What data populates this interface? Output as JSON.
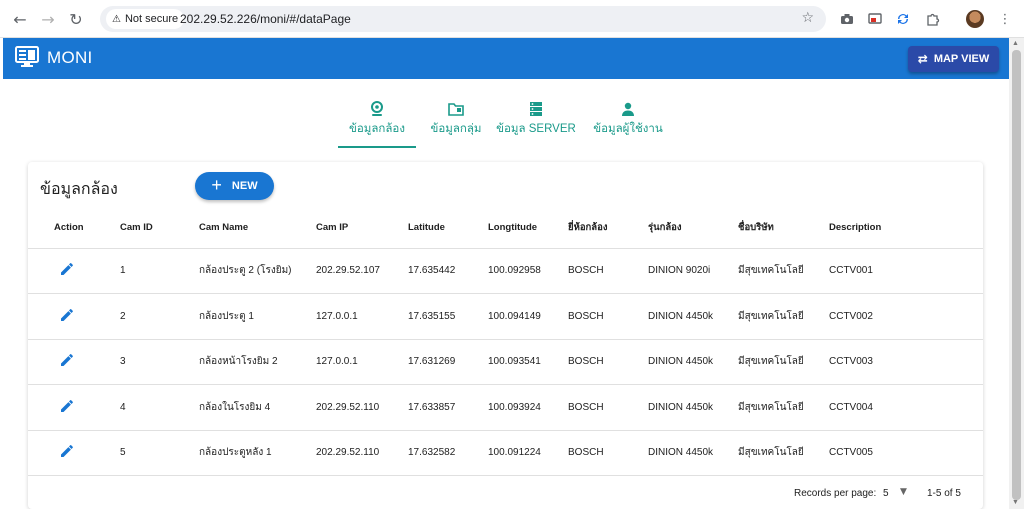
{
  "browser": {
    "secure_label": "Not secure",
    "url": "202.29.52.226/moni/#/dataPage"
  },
  "app": {
    "title": "MONI",
    "map_view_label": "MAP VIEW",
    "accent": "#1976d2"
  },
  "tabs": [
    {
      "label": "ข้อมูลกล้อง",
      "icon": "camera-icon",
      "active": true
    },
    {
      "label": "ข้อมูลกลุ่ม",
      "icon": "folder-icon",
      "active": false
    },
    {
      "label": "ข้อมูล SERVER",
      "icon": "server-icon",
      "active": false
    },
    {
      "label": "ข้อมูลผู้ใช้งาน",
      "icon": "user-icon",
      "active": false
    }
  ],
  "card": {
    "title": "ข้อมูลกล้อง",
    "new_label": "NEW"
  },
  "table": {
    "columns": [
      "Action",
      "Cam ID",
      "Cam Name",
      "Cam IP",
      "Latitude",
      "Longtitude",
      "ยี่ห้อกล้อง",
      "รุ่นกล้อง",
      "ชื่อบริษัท",
      "Description"
    ],
    "rows": [
      [
        "1",
        "กล้องประตู 2 (โรงยิม)",
        "202.29.52.107",
        "17.635442",
        "100.092958",
        "BOSCH",
        "DINION 9020i",
        "มีสุขเทคโนโลยี",
        "CCTV001"
      ],
      [
        "2",
        "กล้องประตู 1",
        "127.0.0.1",
        "17.635155",
        "100.094149",
        "BOSCH",
        "DINION 4450k",
        "มีสุขเทคโนโลยี",
        "CCTV002"
      ],
      [
        "3",
        "กล้องหน้าโรงยิม 2",
        "127.0.0.1",
        "17.631269",
        "100.093541",
        "BOSCH",
        "DINION 4450k",
        "มีสุขเทคโนโลยี",
        "CCTV003"
      ],
      [
        "4",
        "กล้องในโรงยิม 4",
        "202.29.52.110",
        "17.633857",
        "100.093924",
        "BOSCH",
        "DINION 4450k",
        "มีสุขเทคโนโลยี",
        "CCTV004"
      ],
      [
        "5",
        "กล้องประตูหลัง 1",
        "202.29.52.110",
        "17.632582",
        "100.091224",
        "BOSCH",
        "DINION 4450k",
        "มีสุขเทคโนโลยี",
        "CCTV005"
      ]
    ]
  },
  "pager": {
    "records_label": "Records per page:",
    "per_page": "5",
    "range": "1-5 of 5"
  }
}
